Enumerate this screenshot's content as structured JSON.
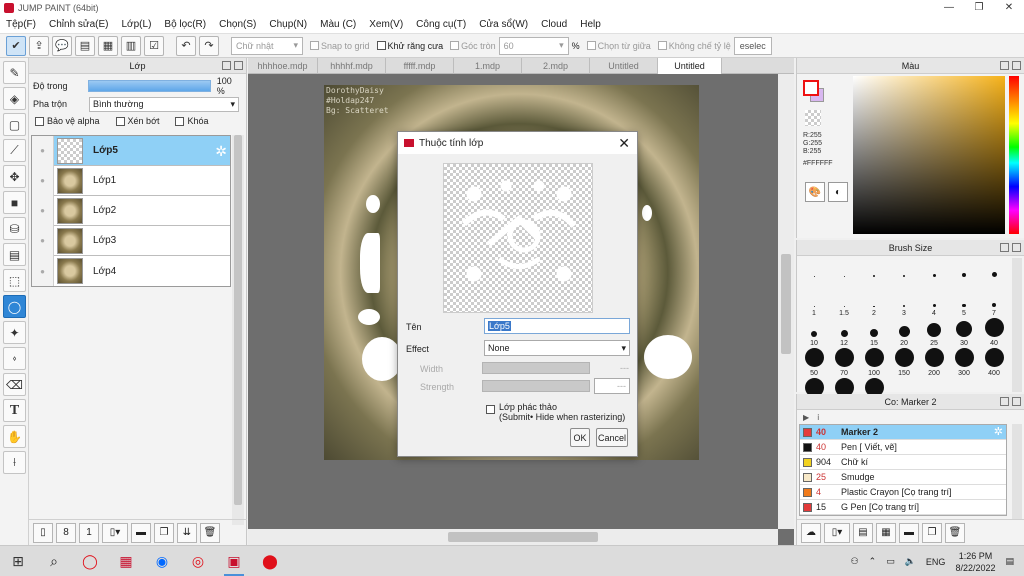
{
  "window": {
    "title": "JUMP PAINT (64bit)",
    "minimize": "—",
    "maximize": "❐",
    "close": "✕"
  },
  "menu": [
    "Tệp(F)",
    "Chỉnh sửa(E)",
    "Lớp(L)",
    "Bộ lọc(R)",
    "Chọn(S)",
    "Chụp(N)",
    "Màu (C)",
    "Xem(V)",
    "Công cụ(T)",
    "Cửa sổ(W)",
    "Cloud",
    "Help"
  ],
  "toolbar": {
    "shape_select": "Chữ nhật",
    "snap_grid": "Snap to grid",
    "antialias": "Khử răng cưa",
    "round_corner": "Góc tròn",
    "round_value": "60",
    "percent": "%",
    "select_center": "Chọn từ giữa",
    "fixed_ratio": "Không chế tỷ lệ",
    "deselect": "eselec"
  },
  "layer_panel": {
    "title": "Lớp",
    "opacity_label": "Độ trong",
    "opacity_value": "100 %",
    "opacity_level": 1.0,
    "blend_label": "Pha trộn",
    "blend_value": "Bình thường",
    "protect_alpha": "Bảo vệ alpha",
    "clipping": "Xén bớt",
    "lock": "Khóa",
    "layers": [
      {
        "name": "Lớp5",
        "selected": true
      },
      {
        "name": "Lớp1",
        "selected": false
      },
      {
        "name": "Lớp2",
        "selected": false
      },
      {
        "name": "Lớp3",
        "selected": false
      },
      {
        "name": "Lớp4",
        "selected": false
      }
    ]
  },
  "tabs": [
    "hhhhoe.mdp",
    "hhhhf.mdp",
    "fffff.mdp",
    "1.mdp",
    "2.mdp",
    "Untitled",
    "Untitled"
  ],
  "artwork": {
    "watermark_line1": "DorothyDaisy",
    "watermark_line2": "#Holdap247",
    "watermark_line3": "Bg: Scatteret"
  },
  "dialog": {
    "title": "Thuộc tính lớp",
    "name_label": "Tên",
    "name_value": "Lớp5",
    "effect_label": "Effect",
    "effect_value": "None",
    "width_label": "Width",
    "width_value": "---",
    "strength_label": "Strength",
    "strength_value": "---",
    "draft_line1": "Lớp phác thảo",
    "draft_line2": "(Submit• Hide when rasterizing)",
    "ok": "OK",
    "cancel": "Cancel"
  },
  "color_panel": {
    "title": "Màu",
    "r": "R:255",
    "g": "G:255",
    "b": "B:255",
    "hex": "#FFFFFF"
  },
  "brush_panel": {
    "title": "Brush Size",
    "sizes": [
      "",
      "",
      "",
      "",
      "",
      "",
      "",
      "1",
      "1.5",
      "2",
      "3",
      "4",
      "5",
      "7",
      "10",
      "12",
      "15",
      "20",
      "25",
      "30",
      "40",
      "50",
      "70",
      "100",
      "150",
      "200",
      "300",
      "400",
      "",
      "",
      ""
    ]
  },
  "tool_panel": {
    "title": "Co: Marker 2",
    "items": [
      {
        "num": "40",
        "name": "Marker 2",
        "color": "#e33b3b",
        "selected": true
      },
      {
        "num": "40",
        "name": "Pen [ Viết, vẽ]",
        "color": "#111111",
        "selected": false
      },
      {
        "num": "904",
        "name": "Chữ kí",
        "color": "#f2d21f",
        "selected": false
      },
      {
        "num": "25",
        "name": "Smudge",
        "color": "#f8e9c8",
        "selected": false
      },
      {
        "num": "4",
        "name": "Plastic Crayon [Cọ trang trí]",
        "color": "#f07a1a",
        "selected": false
      },
      {
        "num": "15",
        "name": "G Pen [Cọ trang trí]",
        "color": "#e33b3b",
        "selected": false
      }
    ]
  },
  "taskbar": {
    "time": "1:26 PM",
    "date": "8/22/2022",
    "lang": "ENG"
  }
}
